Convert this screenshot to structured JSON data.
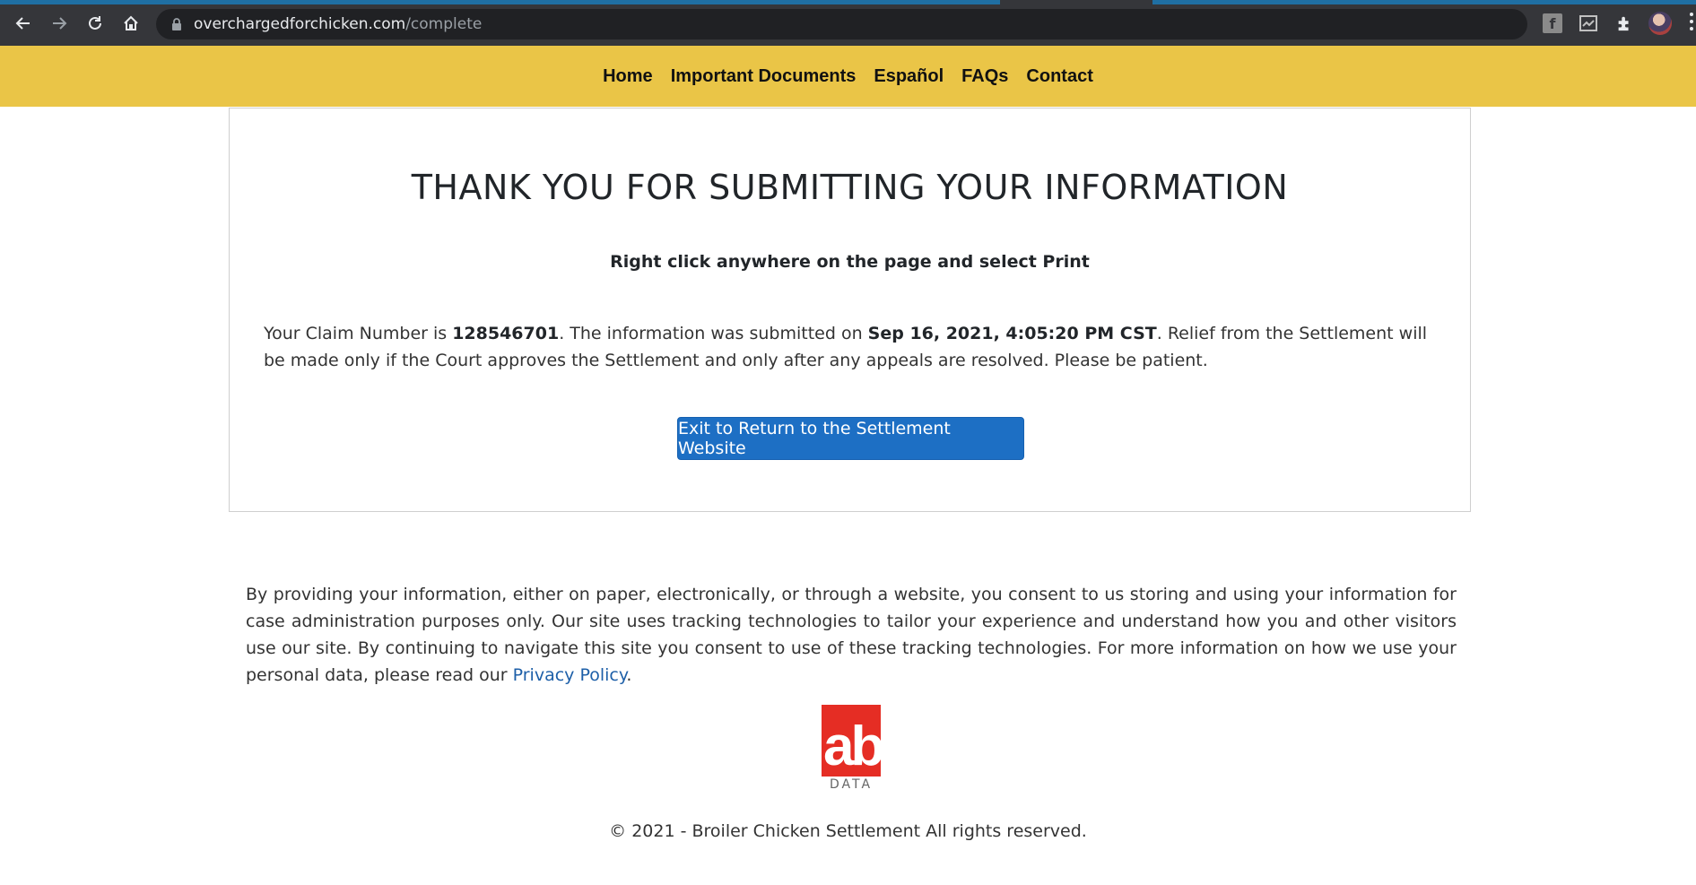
{
  "browser": {
    "url_host": "overchargedforchicken.com",
    "url_path": "/complete"
  },
  "nav": {
    "items": [
      {
        "label": "Home"
      },
      {
        "label": "Important Documents"
      },
      {
        "label": "Español"
      },
      {
        "label": "FAQs"
      },
      {
        "label": "Contact"
      }
    ]
  },
  "card": {
    "title": "THANK YOU FOR SUBMITTING YOUR INFORMATION",
    "print_note": "Right click anywhere on the page and select Print",
    "claim_prefix": "Your Claim Number is ",
    "claim_number": "128546701",
    "submitted_prefix": ". The information was submitted on ",
    "submitted_at": "Sep 16, 2021, 4:05:20 PM CST",
    "relief_text": ". Relief from the Settlement will be made only if the Court approves the Settlement and only after any appeals are resolved. Please be patient.",
    "exit_button": "Exit to Return to the Settlement Website"
  },
  "footer": {
    "consent_text": "By providing your information, either on paper, electronically, or through a website, you consent to us storing and using your information for case administration purposes only. Our site uses tracking technologies to tailor your experience and understand how you and other visitors use our site. By continuing to navigate this site you consent to use of these tracking technologies. For more information on how we use your personal data, please read our ",
    "privacy_link": "Privacy Policy",
    "consent_end": ".",
    "logo_mark": "ab",
    "logo_sub": "DATA",
    "copyright": "© 2021 - Broiler Chicken Settlement All rights reserved."
  },
  "colors": {
    "nav_bg": "#eac547",
    "button_bg": "#1d6fc4",
    "link": "#1d5fa8",
    "logo_red": "#e52d24"
  }
}
